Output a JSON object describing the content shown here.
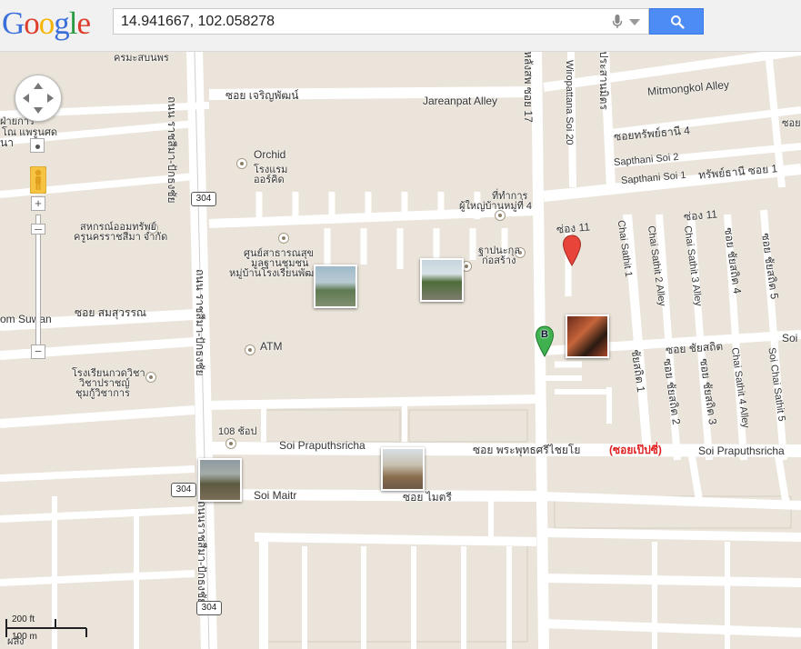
{
  "search": {
    "logo_text": "Google",
    "query": "14.941667, 102.058278"
  },
  "map_labels": {
    "soi_charoenphon_th": "ซอย เจริญพัฒน์",
    "jareanpat_alley": "Jareanpat Alley",
    "thanon_ratchasima_top": "ถนน ราชสีมา-ปักธงชัย",
    "thanon_ratchasima_mid": "ถนน ราชสีมา-ปักธงชัย",
    "thanon_ratchasima_low": "ถนนราชสีมา-ปักธงชัย",
    "na_fragment": "นา",
    "top_left_1": "ฝ่ายการ",
    "top_left_2": "โณ แพรูนศด",
    "top_cut": "ครมะสบนพร",
    "nabpha_soi17": "หลังสพ ซอย 17",
    "wiropattana": "Wiropattana Soi 20",
    "prasarnmit": "ประสานมิตร",
    "mitmongkol": "Mitmongkol Alley",
    "soi_sapthani4": "ซอยทรัพย์ธานี 4",
    "sapthani_soi2": "Sapthani Soi 2",
    "sapthani_soi1": "Sapthani Soi 1",
    "sapthani1_th": "ทรัพย์ธานี ซอย 1",
    "soi2_th": "ซอย 2",
    "orchid_en": "Orchid",
    "orchid_th1": "โรงแรม",
    "orchid_th2": "ออร์คิด",
    "office_th1": "ที่ทำการ",
    "office_th2": "ผู้ใหญ่บ้านหมู่ที่ 4",
    "shop_th1": "สหกรณ์ออมทรัพย์",
    "shop_th2": "ครูนครราชสีมา จำกัด",
    "health_th1": "ศูนย์สาธารณสุข",
    "health_th2": "มูลฐานชุมชน",
    "health_th3": "หมู่บ้านโรงเรียนพัฒนา",
    "temple_th1": "ฐาปนะกุล",
    "temple_th2": "ก่อสร้าง",
    "song11_a": "ซ่อง 11",
    "song11_b": "ซ่อง 11",
    "chai_sathit1": "Chai Sathit 1",
    "chai_sathit2": "Chai Sathit 2 Alley",
    "chai_sathit3": "Chai Sathit 3 Alley",
    "soi_chaisathit4": "ซอย ชัยสถิต 4",
    "soi_chaisathit5": "ซอย ชัยสถิต 5",
    "soi_chaisathit": "ซอย ชัยสถิต",
    "soi_cut": "Soi",
    "om_suwan": "om Suwan",
    "soi_somsuwan": "ซอย สมสุวรรณ",
    "atm": "ATM",
    "school_th1": "โรงเรียนกวดวิชา",
    "school_th2": "วิชาปราชญ์",
    "school_th3": "ชุมกู้วิชาการ",
    "chaisathit1_th": "ชัยสถิต 1",
    "soi_chaisathit2_th": "ซอย ชัยสถิต 2",
    "soi_chaisathit3_th": "ซอย ชัยสถิต 3",
    "chai_sathit4_alley": "Chai Sathit 4 Alley",
    "soi_chai_sathit5": "Soi Chai Sathit 5",
    "junction108": "108 ช้อป",
    "soi_praputhsricha_a": "Soi Praputhsricha",
    "soi_praputhsricha_th": "ซอย พระพุทธศรีไชยโย",
    "soi_pepsi": "(ซอยเป๊ปซี่)",
    "soi_praputhsricha_b": "Soi Praputhsricha",
    "soi_maitr": "Soi Maitr",
    "soi_maitri_th": "ซอย ไมตรี",
    "bottom_left": "ผลัง"
  },
  "shields": {
    "r304_a": "304",
    "r304_b": "304",
    "r304_c": "304"
  },
  "markers": {
    "marker_b": "B"
  },
  "scale": {
    "feet": "200 ft",
    "meters": "100 m"
  },
  "colors": {
    "land": "#eae4da",
    "road": "#ffffff",
    "search_button": "#4d8cf4",
    "marker_red": "#e8443a",
    "marker_green": "#3fb14e"
  }
}
